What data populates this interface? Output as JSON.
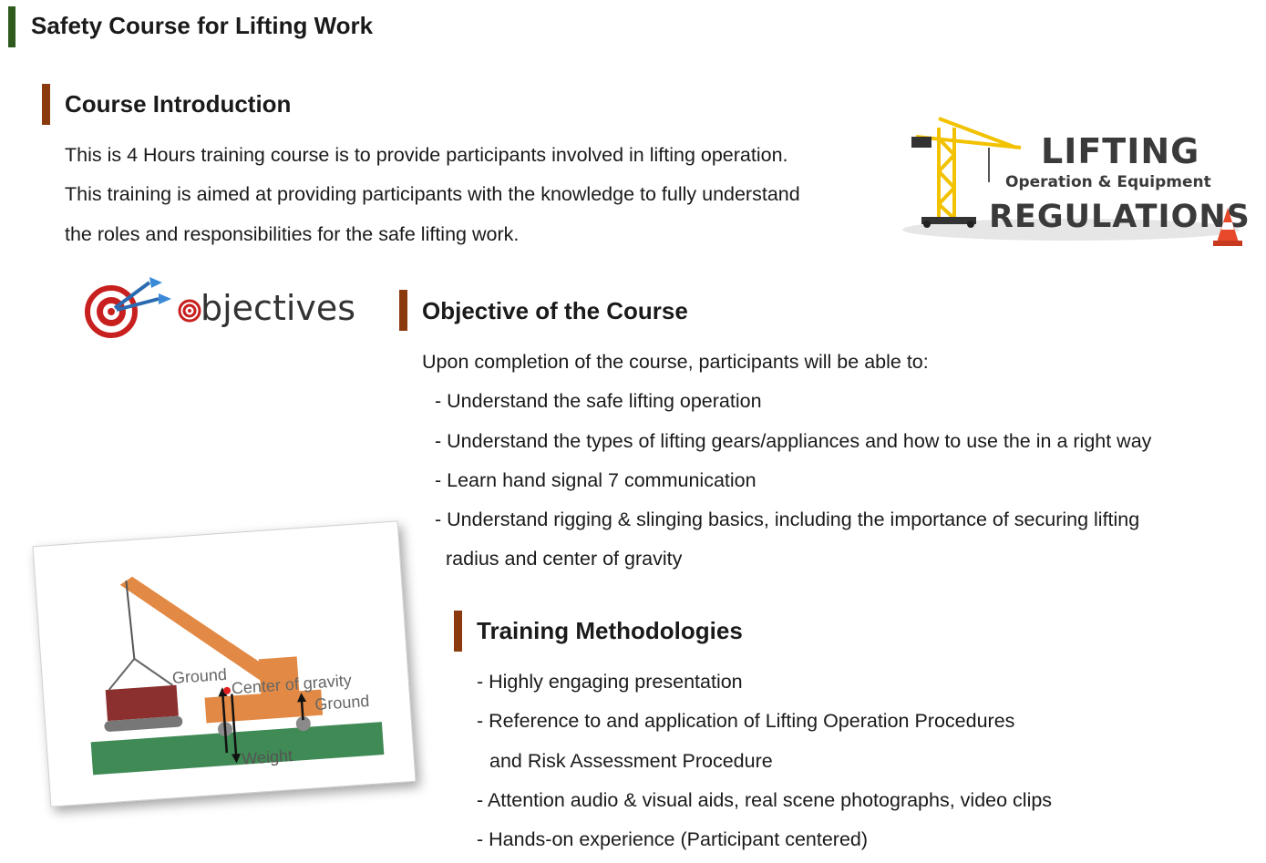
{
  "page": {
    "title": "Safety Course for Lifting Work"
  },
  "intro": {
    "heading": "Course Introduction",
    "lines": [
      "This is 4 Hours training course is to provide participants involved in lifting operation.",
      "This training is aimed at providing participants with the knowledge to fully understand",
      "the roles and responsibilities for the safe lifting work."
    ]
  },
  "lifting_logo": {
    "word1": "LIFTING",
    "word2": "Operation & Equipment",
    "word3": "REGULATIONS"
  },
  "objectives_logo": {
    "word": "bjectives"
  },
  "objective": {
    "heading": "Objective of the Course",
    "intro": "Upon completion of the course, participants will be able to:",
    "items": [
      "- Understand the safe lifting operation",
      "- Understand the types of lifting gears/appliances and how to use the in a right way",
      "- Learn hand signal 7 communication",
      "- Understand rigging & slinging basics, including the importance of securing lifting",
      "radius and center of gravity"
    ]
  },
  "methodologies": {
    "heading": "Training Methodologies",
    "items": [
      "- Highly engaging presentation",
      "- Reference to and application of Lifting Operation Procedures",
      "and Risk Assessment Procedure",
      "- Attention audio & visual aids, real scene photographs, video clips",
      "- Hands-on experience (Participant centered)"
    ]
  },
  "diagram": {
    "label_ground_left": "Ground",
    "label_cog": "Center of gravity",
    "label_ground_right": "Ground",
    "label_weight": "Weight"
  },
  "colors": {
    "title_bar": "#2e5a1e",
    "section_bar": "#8b3a0e",
    "crane_yellow": "#f2c200",
    "logo_text": "#3a3a3a",
    "boom_orange": "#e28a45",
    "ground_green": "#3f8a55",
    "load_red": "#8c2f2f"
  }
}
